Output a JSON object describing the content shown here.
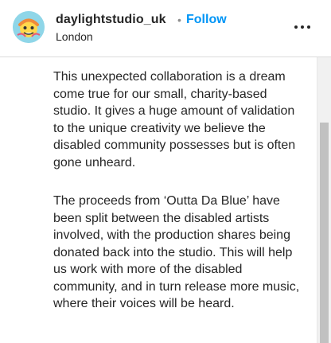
{
  "post_header": {
    "account_name": "daylightstudio_uk",
    "separator": "•",
    "follow_label": "Follow",
    "location": "London",
    "more_icon": "more-horizontal-icon",
    "avatar_icon": "profile-avatar"
  },
  "caption": {
    "paragraph_1": "This unexpected collaboration is a dream come true for our small, charity-based studio. It gives a huge amount of validation to the unique creativity we believe the disabled community possesses but is often gone unheard.",
    "paragraph_2": "The proceeds from ‘Outta Da Blue’ have been split between the disabled artists involved, with the production shares being donated back into the studio. This will help us work with more of the disabled community, and in turn release more music, where their voices will be heard."
  },
  "colors": {
    "text": "#262626",
    "follow": "#0095f6",
    "divider": "#dbdbdb",
    "avatar_bg": "#8fd6e8"
  }
}
